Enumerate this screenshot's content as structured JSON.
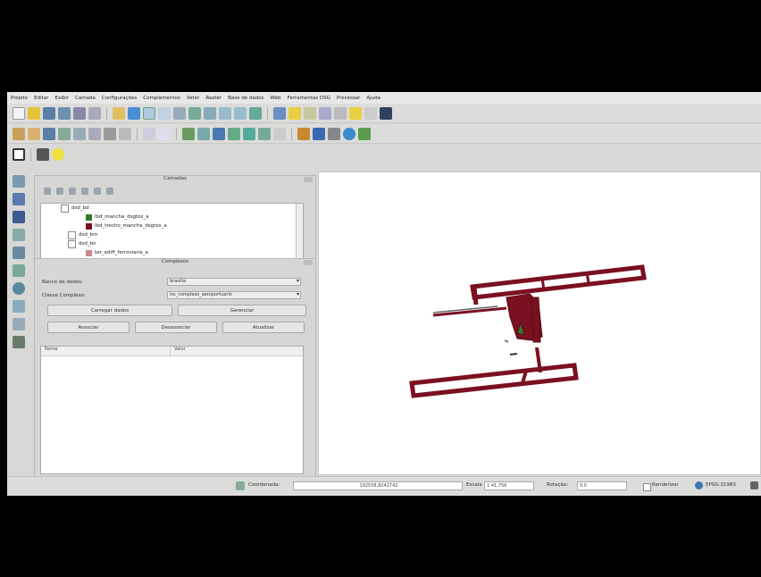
{
  "menu": [
    "Projeto",
    "Editar",
    "Exibir",
    "Camada",
    "Configurações",
    "Complementos",
    "Vetor",
    "Raster",
    "Base de dados",
    "Web",
    "Ferramentas DSG",
    "Processar",
    "Ajuda"
  ],
  "layers_panel": {
    "title": "Camadas",
    "items": [
      {
        "label": "dsd_bd"
      },
      {
        "label": "lbd_mancha_dsgtos_a",
        "color": "#2e7a2e"
      },
      {
        "label": "lbd_trecho_mancha_dsgtos_a",
        "color": "#7a1020"
      },
      {
        "label": "dsd_bm"
      },
      {
        "label": "dsd_bn"
      },
      {
        "label": "ter_adiff_ferroviaria_a"
      }
    ]
  },
  "tables_panel": {
    "title": "Complexos",
    "db_label": "Banco de dados:",
    "db_value": "brasilia",
    "class_label": "Classe Complexo:",
    "class_value": "lss_complexo_aeroportuario",
    "load_button": "Carregar dados",
    "manage_button": "Gerenciar",
    "associate_button": "Associar",
    "disassociate_button": "Desassociar",
    "update_button": "Atualizar",
    "col_name": "Nome",
    "col_class": "Valor"
  },
  "statusbar": {
    "coordinate_label": "Coordenada:",
    "coordinate_value": "192558,8242742",
    "scale_label": "Escala",
    "scale_value": "1:41.756",
    "rotation_label": "Rotação:",
    "rotation_value": "0,0",
    "render_label": "Renderizar",
    "crs_label": "EPSG:31983"
  },
  "colors": {
    "feature_fill": "#7a1020",
    "feature_outline": "#5a0c18",
    "accent_swatch_green": "#2e7a2e"
  },
  "icons": [
    "new-project-icon",
    "open-icon",
    "save-icon",
    "pan-icon",
    "zoom-in-icon",
    "zoom-out-icon",
    "identify-icon",
    "select-icon",
    "python-icon",
    "edit-pencil-icon",
    "add-vector-icon",
    "add-raster-icon",
    "add-postgis-icon"
  ]
}
